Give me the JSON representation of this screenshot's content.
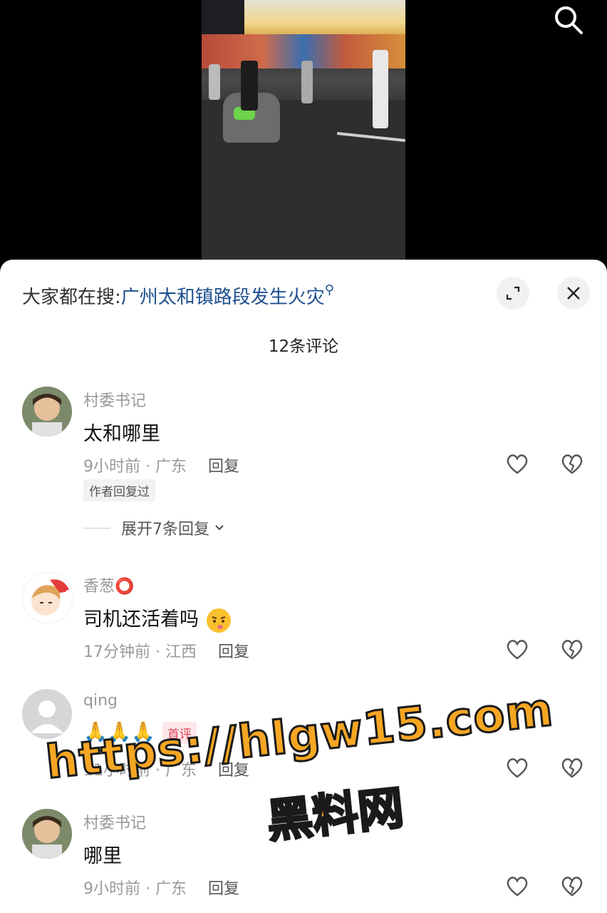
{
  "search_icon": "search-icon",
  "hot_search": {
    "prefix": "大家都在搜:",
    "keyword": "广州太和镇路段发生火灾",
    "icon": "magnifier-small-icon"
  },
  "sheet_buttons": {
    "expand_icon": "expand-icon",
    "close_icon": "close-icon"
  },
  "comment_count": "12条评论",
  "comments": [
    {
      "username": "村委书记",
      "text": "太和哪里",
      "time_location": "9小时前 · 广东",
      "reply_label": "回复",
      "author_tag": "作者回复过",
      "expand_replies": "展开7条回复"
    },
    {
      "username": "香葱⭕",
      "text": "司机还活着吗",
      "time_location": "17分钟前 · 江西",
      "reply_label": "回复"
    },
    {
      "username": "qing",
      "text": "🙏🙏🙏",
      "first_tag": "首评",
      "time_location": "11小时前 · 广东",
      "reply_label": "回复"
    },
    {
      "username": "村委书记",
      "text": "哪里",
      "time_location": "9小时前 · 广东",
      "reply_label": "回复"
    }
  ],
  "watermark": {
    "line1": "https://hlgw15.com",
    "line2": "黑料网"
  },
  "colors": {
    "keyword": "#1d4f8f",
    "watermark": "#f6a623",
    "first_tag": "#e4465c"
  }
}
